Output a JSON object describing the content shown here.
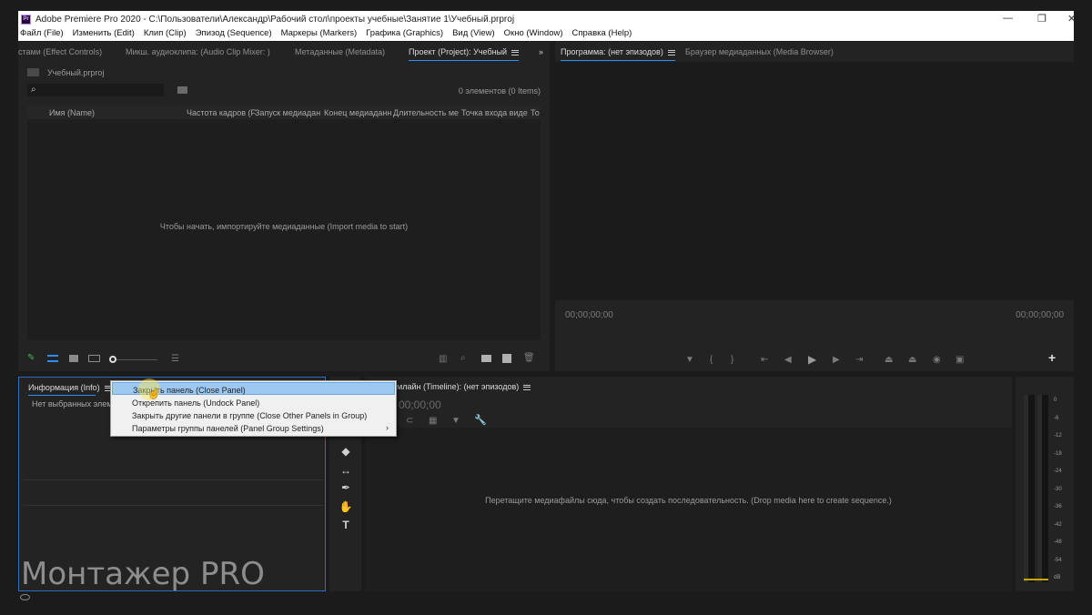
{
  "window": {
    "title": "Adobe Premiere Pro 2020 - C:\\Пользователи\\Александр\\Рабочий стол\\проекты учебные\\Занятие 1\\Учебный.prproj",
    "app_icon": "Pr",
    "controls": [
      "—",
      "❐",
      "✕"
    ]
  },
  "menu": [
    "Файл (File)",
    "Изменить (Edit)",
    "Клип (Clip)",
    "Эпизод (Sequence)",
    "Маркеры (Markers)",
    "Графика (Graphics)",
    "Вид (View)",
    "Окно (Window)",
    "Справка (Help)"
  ],
  "top_tabs": {
    "effect_controls": "стами (Effect Controls)",
    "audio_mixer": "Микш. аудиоклипа: (Audio Clip Mixer: )",
    "metadata": "Метаданные (Metadata)",
    "project": "Проект (Project): Учебный",
    "overflow": "»"
  },
  "right_tabs": {
    "program": "Программа: (нет эпизодов)",
    "media_browser": "Браузер медиаданных (Media Browser)"
  },
  "project": {
    "file": "Учебный.prproj",
    "items_count": "0 элементов (0 Items)",
    "search_placeholder": "",
    "columns": [
      "Имя (Name)",
      "Частота кадров (F",
      "Запуск медиадан",
      "Конец медиаданн",
      "Длительность ме",
      "Точка входа виде",
      "То"
    ],
    "empty_msg": "Чтобы начать, импортируйте медиаданные (Import media to start)"
  },
  "program": {
    "timecode_left": "00;00;00;00",
    "timecode_right": "00;00;00;00",
    "add_button": "+"
  },
  "info": {
    "tab": "Информация (Info)",
    "message": "Нет выбранных элеме"
  },
  "context_menu": [
    "Закрыть панель (Close Panel)",
    "Открепить панель (Undock Panel)",
    "Закрыть другие панели в группе (Close Other Panels in Group)",
    "Параметры группы панелей (Panel Group Settings)"
  ],
  "timeline": {
    "tab": "млайн (Timeline): (нет эпизодов)",
    "timecode": "00;00;00",
    "empty_msg": "Перетащите медиафайлы сюда, чтобы создать последовательность. (Drop media here to create sequence.)"
  },
  "audio_meter": {
    "labels": [
      "0",
      "-6",
      "-12",
      "-18",
      "-24",
      "-30",
      "-36",
      "-42",
      "-48",
      "-54",
      "dB"
    ]
  },
  "watermark": "Монтажер PRO",
  "colors": {
    "accent": "#2f8df5",
    "highlight": "#9cc8f2",
    "panel_bg": "#232323",
    "label_green": "#4caf50"
  }
}
